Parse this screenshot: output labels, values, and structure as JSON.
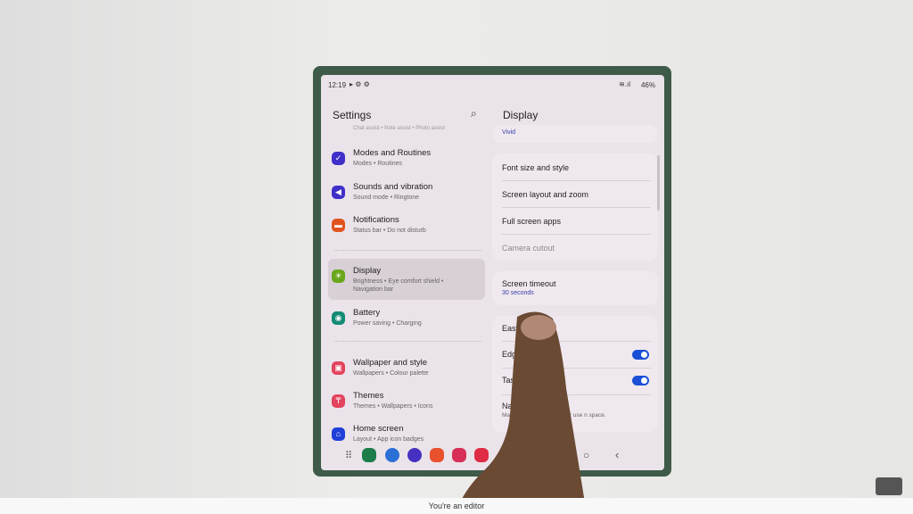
{
  "status": {
    "time": "12:19",
    "battery": "46%"
  },
  "left": {
    "title": "Settings",
    "partial": "Chat assist • Note assist • Photo assist",
    "items": [
      {
        "title": "Modes and Routines",
        "sub": "Modes • Routines",
        "color": "#3f2fc9",
        "icon": "check-circle-icon"
      },
      {
        "title": "Sounds and vibration",
        "sub": "Sound mode • Ringtone",
        "color": "#3f2fc9",
        "icon": "speaker-icon"
      },
      {
        "title": "Notifications",
        "sub": "Status bar • Do not disturb",
        "color": "#e0531f",
        "icon": "notification-icon"
      },
      {
        "title": "Display",
        "sub": "Brightness • Eye comfort shield • Navigation bar",
        "color": "#6aa61a",
        "icon": "sun-icon"
      },
      {
        "title": "Battery",
        "sub": "Power saving • Charging",
        "color": "#138b74",
        "icon": "battery-icon"
      },
      {
        "title": "Wallpaper and style",
        "sub": "Wallpapers • Colour palette",
        "color": "#e2435e",
        "icon": "image-icon"
      },
      {
        "title": "Themes",
        "sub": "Themes • Wallpapers • Icons",
        "color": "#e2435e",
        "icon": "brush-icon"
      },
      {
        "title": "Home screen",
        "sub": "Layout • App icon badges",
        "color": "#1f3fd8",
        "icon": "home-icon"
      }
    ]
  },
  "right": {
    "title": "Display",
    "vivid": "Vivid",
    "group1": [
      "Font size and style",
      "Screen layout and zoom",
      "Full screen apps",
      "Camera cutout"
    ],
    "timeout": {
      "title": "Screen timeout",
      "value": "30 seconds"
    },
    "group3": {
      "easy": "Easy",
      "edge": "Edge",
      "task": "Task",
      "nav": "Navi",
      "nav_desc": "Mana                  d Recents buttons or use                      n space."
    },
    "toggles": {
      "edge": true,
      "task": true
    }
  },
  "caption": "You're an editor",
  "accent": "#1a4fd6"
}
